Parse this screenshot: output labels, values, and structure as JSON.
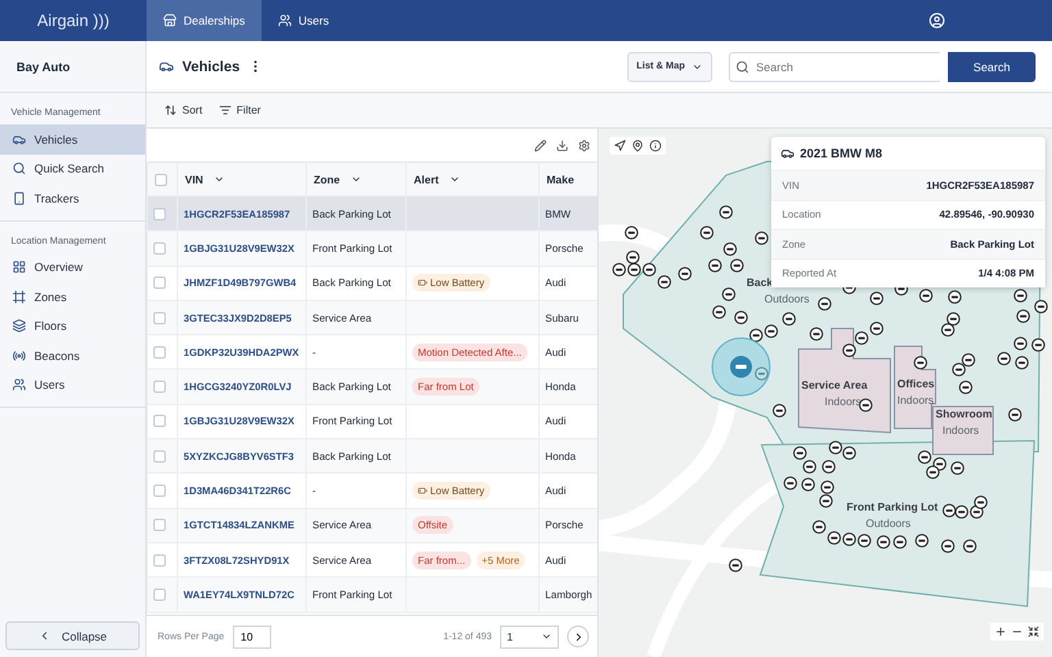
{
  "app": {
    "logo": "Airgain )))",
    "nav_tabs": [
      {
        "label": "Dealerships",
        "selected": true
      },
      {
        "label": "Users",
        "selected": false
      }
    ]
  },
  "sidebar": {
    "title": "Bay Auto",
    "sections": [
      {
        "heading": "Vehicle Management",
        "items": [
          {
            "label": "Vehicles",
            "selected": true
          },
          {
            "label": "Quick Search",
            "selected": false
          },
          {
            "label": "Trackers",
            "selected": false
          }
        ]
      },
      {
        "heading": "Location Management",
        "items": [
          {
            "label": "Overview",
            "selected": false
          },
          {
            "label": "Zones",
            "selected": false
          },
          {
            "label": "Floors",
            "selected": false
          },
          {
            "label": "Beacons",
            "selected": false
          },
          {
            "label": "Users",
            "selected": false
          }
        ]
      }
    ],
    "collapse": "Collapse"
  },
  "main": {
    "title": "Vehicles",
    "view_select": "List & Map",
    "search": {
      "placeholder": "Search",
      "button": "Search"
    },
    "toolbar": [
      "Sort",
      "Filter"
    ]
  },
  "table": {
    "select_all_checked": false,
    "columns": [
      "VIN",
      "Zone",
      "Alert",
      "Make"
    ],
    "rows": [
      {
        "vin": "1HGCR2F53EA185987",
        "zone": "Back Parking Lot",
        "alerts": [],
        "make": "BMW",
        "selected": true,
        "checked": false
      },
      {
        "vin": "1GBJG31U28V9EW32X",
        "zone": "Front Parking Lot",
        "alerts": [],
        "make": "Porsche",
        "selected": false,
        "checked": false
      },
      {
        "vin": "JHMZF1D49B797GWB4",
        "zone": "Back Parking Lot",
        "alerts": [
          {
            "text": "Low Battery",
            "kind": "battery"
          }
        ],
        "make": "Audi",
        "selected": false,
        "checked": false
      },
      {
        "vin": "3GTEC33JX9D2D8EP5",
        "zone": "Service Area",
        "alerts": [],
        "make": "Subaru",
        "selected": false,
        "checked": false
      },
      {
        "vin": "1GDKP32U39HDA2PWX",
        "zone": "-",
        "alerts": [
          {
            "text": "Motion Detected Afte...",
            "kind": "danger"
          }
        ],
        "make": "Audi",
        "selected": false,
        "checked": false
      },
      {
        "vin": "1HGCG3240YZ0R0LVJ",
        "zone": "Back Parking Lot",
        "alerts": [
          {
            "text": "Far from Lot",
            "kind": "danger"
          }
        ],
        "make": "Honda",
        "selected": false,
        "checked": false
      },
      {
        "vin": "1GBJG31U28V9EW32X",
        "zone": "Front Parking Lot",
        "alerts": [],
        "make": "Audi",
        "selected": false,
        "checked": false
      },
      {
        "vin": "5XYZKCJG8BYV6STF3",
        "zone": "Back Parking Lot",
        "alerts": [],
        "make": "Honda",
        "selected": false,
        "checked": false
      },
      {
        "vin": "1D3MA46D341T22R6C",
        "zone": "-",
        "alerts": [
          {
            "text": "Low Battery",
            "kind": "battery"
          }
        ],
        "make": "Audi",
        "selected": false,
        "checked": false
      },
      {
        "vin": "1GTCT14834LZANKME",
        "zone": "Service Area",
        "alerts": [
          {
            "text": "Offsite",
            "kind": "danger"
          }
        ],
        "make": "Porsche",
        "selected": false,
        "checked": false
      },
      {
        "vin": "3FTZX08L72SHYD91X",
        "zone": "Service Area",
        "alerts": [
          {
            "text": "Far from...",
            "kind": "danger"
          },
          {
            "text": "+5 More",
            "kind": "more"
          }
        ],
        "make": "Audi",
        "selected": false,
        "checked": false
      },
      {
        "vin": "WA1EY74LX9TNLD72C",
        "zone": "Front Parking Lot",
        "alerts": [],
        "make": "Lamborgh",
        "selected": false,
        "checked": false
      }
    ]
  },
  "footer": {
    "rows_per_page_label": "Rows Per Page",
    "rows_per_page": "10",
    "range": "1-12 of 493",
    "page": "1"
  },
  "map": {
    "zones": [
      {
        "name": "Back",
        "type": "Outdoors"
      },
      {
        "name": "Service Area",
        "type": "Indoors"
      },
      {
        "name": "Offices",
        "type": "Indoors"
      },
      {
        "name": "Showroom",
        "type": "Indoors"
      },
      {
        "name": "Front Parking Lot",
        "type": "Outdoors"
      }
    ],
    "popup": {
      "title": "2021 BMW M8",
      "fields": [
        {
          "label": "VIN",
          "value": "1HGCR2F53EA185987"
        },
        {
          "label": "Location",
          "value": "42.89546, -90.90930"
        },
        {
          "label": "Zone",
          "value": "Back Parking Lot"
        },
        {
          "label": "Reported At",
          "value": "1/4 4:08 PM"
        }
      ]
    }
  }
}
